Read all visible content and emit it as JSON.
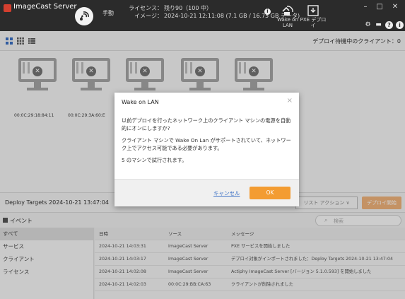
{
  "app": {
    "title": "ImageCast Server"
  },
  "header": {
    "mode_label": "手動",
    "license_label": "ライセンス：",
    "license_value": "残り90（100 中）",
    "image_label": "イメージ：",
    "image_value": "2024-10-21 12:11:08 (7.1 GB / 16.75 GB データ)",
    "wake_on_lan_label": "Wake on LAN",
    "pxe_deploy_label": "PXE デプロイ"
  },
  "viewbar": {
    "waiting_clients": "デプロイ待機中のクライアント：0"
  },
  "clients": [
    {
      "mac": "00:0C:29:18:84:11"
    },
    {
      "mac": "00:0C:29:3A:60:E"
    },
    {
      "mac": ""
    },
    {
      "mac": ""
    },
    {
      "mac": ""
    }
  ],
  "deploy": {
    "targets_label": "Deploy Targets 2024-10-21 13:47:04",
    "list_action": "リスト アクション ∨",
    "deploy_start": "デプロイ開始"
  },
  "events": {
    "title": "イベント",
    "search_placeholder": "検索",
    "categories": [
      "すべて",
      "サービス",
      "クライアント",
      "ライセンス"
    ],
    "columns": [
      "日時",
      "ソース",
      "メッセージ"
    ],
    "rows": [
      {
        "time": "2024-10-21 14:03:31",
        "source": "ImageCast Server",
        "message": "PXE サービスを開始しました"
      },
      {
        "time": "2024-10-21 14:03:17",
        "source": "ImageCast Server",
        "message": "デプロイ対象がインポートされました：Deploy Targets 2024-10-21 13:47:04"
      },
      {
        "time": "2024-10-21 14:02:08",
        "source": "ImageCast Server",
        "message": "Actiphy ImageCast Server [バージョン 5.1.0.593] を開始しました"
      },
      {
        "time": "2024-10-21 14:02:03",
        "source": "00:0C:29:BB:CA:63",
        "message": "クライアントが削除されました"
      }
    ]
  },
  "dialog": {
    "title": "Wake on LAN",
    "paragraph1": "以前デプロイを行ったネットワーク上のクライアント マシンの電源を自動的にオンにしますか?",
    "paragraph2": "クライアント マシンで Wake On Lan がサポートされていて、ネットワーク上でアクセス可能である必要があります。",
    "paragraph3": "5 のマシンで試行されます。",
    "cancel": "キャンセル",
    "ok": "OK"
  }
}
